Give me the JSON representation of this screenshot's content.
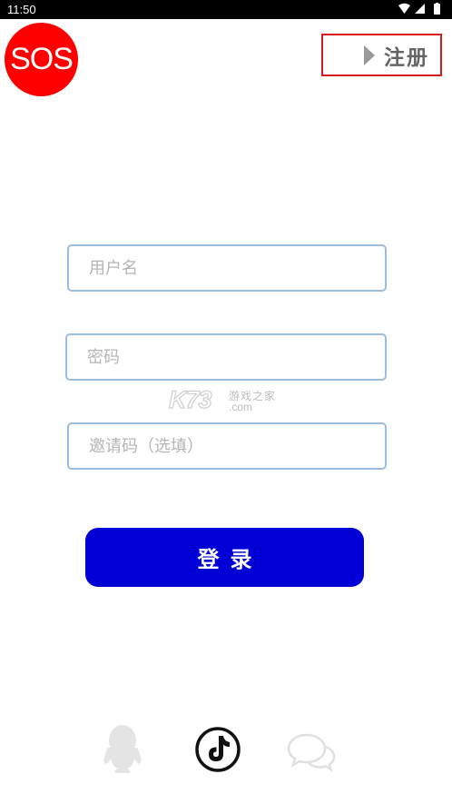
{
  "status_bar": {
    "time": "11:50",
    "icons": [
      "wifi-icon",
      "signal-icon",
      "battery-icon"
    ]
  },
  "header": {
    "sos_label": "SOS",
    "register_label": "注册",
    "register_border_color": "#d81a1a"
  },
  "form": {
    "username": {
      "placeholder": "用户名",
      "value": ""
    },
    "password": {
      "placeholder": "密码",
      "value": ""
    },
    "invite_code": {
      "placeholder": "邀请码（选填）",
      "value": ""
    },
    "login_label": "登录"
  },
  "watermark": {
    "brand": "K73",
    "cn": "游戏之家",
    "domain": ".com"
  },
  "social_login": {
    "icons": [
      "qq-icon",
      "tiktok-icon",
      "wechat-icon"
    ]
  },
  "colors": {
    "sos_red": "#ff0000",
    "login_blue": "#0000d6",
    "input_border": "#9bbde3"
  }
}
